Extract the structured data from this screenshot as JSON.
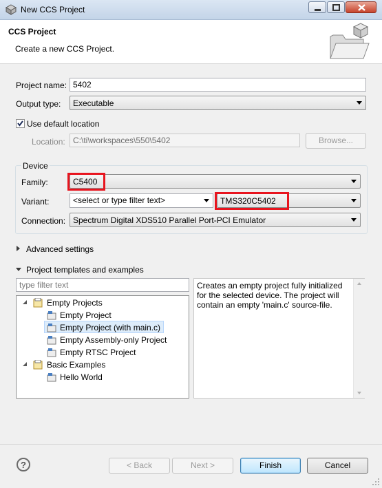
{
  "window": {
    "title": "New CCS Project"
  },
  "header": {
    "title": "CCS Project",
    "subtitle": "Create a new CCS Project."
  },
  "project_name": {
    "label": "Project name:",
    "value": "5402"
  },
  "output_type": {
    "label": "Output type:",
    "value": "Executable"
  },
  "default_location": {
    "label": "Use default location",
    "checked": true
  },
  "location": {
    "label": "Location:",
    "value": "C:\\ti\\workspaces\\550\\5402",
    "browse_label": "Browse..."
  },
  "device": {
    "group_label": "Device",
    "family_label": "Family:",
    "family_value": "C5400",
    "variant_label": "Variant:",
    "variant_filter": "<select or type filter text>",
    "variant_value": "TMS320C5402",
    "connection_label": "Connection:",
    "connection_value": "Spectrum Digital XDS510 Parallel Port-PCI Emulator"
  },
  "advanced": {
    "label": "Advanced settings"
  },
  "templates": {
    "label": "Project templates and examples",
    "filter_placeholder": "type filter text",
    "tree": {
      "empty_projects": "Empty Projects",
      "empty_project": "Empty Project",
      "empty_project_main": "Empty Project (with main.c)",
      "empty_assembly": "Empty Assembly-only Project",
      "empty_rtsc": "Empty RTSC Project",
      "basic_examples": "Basic Examples",
      "hello_world": "Hello World"
    },
    "description": "Creates an empty project fully initialized for the selected device. The project will contain an empty 'main.c' source-file."
  },
  "buttons": {
    "back": "< Back",
    "next": "Next >",
    "finish": "Finish",
    "cancel": "Cancel"
  },
  "colors": {
    "highlight": "#e8141e",
    "selection": "#ddecfa"
  }
}
